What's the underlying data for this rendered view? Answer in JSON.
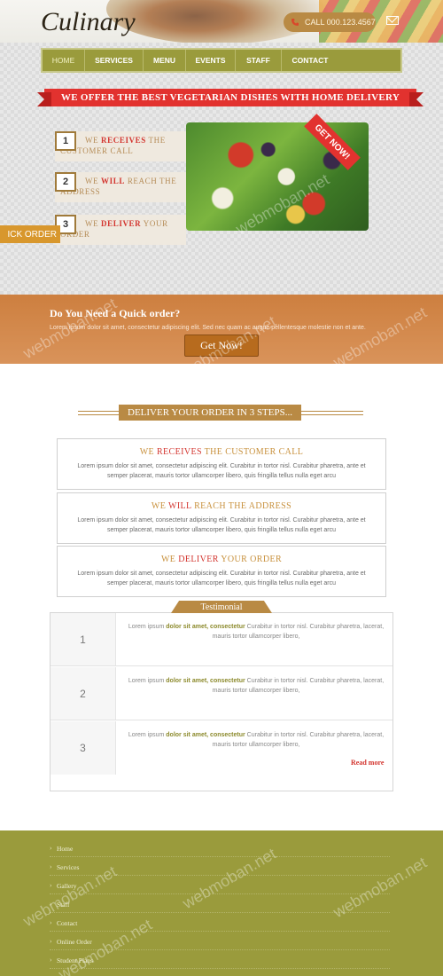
{
  "header": {
    "logo": "Culinary",
    "call_label": "CALL 000.123.4567",
    "phone_icon": "phone-icon",
    "mail_icon": "mail-icon"
  },
  "nav": {
    "items": [
      {
        "label": "HOME",
        "active": true
      },
      {
        "label": "SERVICES",
        "active": false
      },
      {
        "label": "MENU",
        "active": false
      },
      {
        "label": "EVENTS",
        "active": false
      },
      {
        "label": "STAFF",
        "active": false
      },
      {
        "label": "CONTACT",
        "active": false
      }
    ]
  },
  "hero": {
    "ribbon": "WE OFFER THE BEST VEGETARIAN DISHES WITH HOME DELIVERY",
    "steps": [
      {
        "number": "1",
        "pre": "WE ",
        "bold": "RECEIVES",
        "post": " THE CUSTOMER CALL"
      },
      {
        "number": "2",
        "pre": "WE ",
        "bold": "WILL",
        "post": " REACH THE ADDRESS"
      },
      {
        "number": "3",
        "pre": "WE ",
        "bold": "DELIVER",
        "post": " YOUR ORDER"
      }
    ],
    "quick_tab": "ICK ORDER",
    "get_now_badge": "GET NOW!"
  },
  "quick_order": {
    "title": "Do You Need a Quick order?",
    "description": "Lorem ipsum dolor sit amet, consectetur adipiscing elit. Sed nec quam ac augue pellentesque molestie non et ante.",
    "button": "Get Now!"
  },
  "deliver": {
    "heading": "DELIVER YOUR ORDER IN 3 STEPS...",
    "boxes": [
      {
        "pre": "WE ",
        "bold": "RECEIVES",
        "post": " THE CUSTOMER CALL",
        "text": "Lorem ipsum dolor sit amet, consectetur adipiscing elit. Curabitur in tortor nisl. Curabitur pharetra, ante et semper placerat, mauris tortor ullamcorper libero, quis fringilla tellus nulla eget arcu"
      },
      {
        "pre": "WE ",
        "bold": "WILL",
        "post": " REACH THE ADDRESS",
        "text": "Lorem ipsum dolor sit amet, consectetur adipiscing elit. Curabitur in tortor nisl. Curabitur pharetra, ante et semper placerat, mauris tortor ullamcorper libero, quis fringilla tellus nulla eget arcu"
      },
      {
        "pre": "WE ",
        "bold": "DELIVER",
        "post": " YOUR ORDER",
        "text": "Lorem ipsum dolor sit amet, consectetur adipiscing elit. Curabitur in tortor nisl. Curabitur pharetra, ante et semper placerat, mauris tortor ullamcorper libero, quis fringilla tellus nulla eget arcu"
      }
    ]
  },
  "testimonial": {
    "title": "Testimonial",
    "rows": [
      {
        "number": "1",
        "pre": "Lorem ipsum ",
        "bold": "dolor sit amet, consectetur",
        "post": " Curabitur in tortor nisl. Curabitur pharetra, lacerat, mauris tortor ullamcorper libero,"
      },
      {
        "number": "2",
        "pre": "Lorem ipsum ",
        "bold": "dolor sit amet, consectetur",
        "post": " Curabitur in tortor nisl. Curabitur pharetra, lacerat, mauris tortor ullamcorper libero,"
      },
      {
        "number": "3",
        "pre": "Lorem ipsum ",
        "bold": "dolor sit amet, consectetur",
        "post": " Curabitur in tortor nisl. Curabitur pharetra, lacerat, mauris tortor ullamcorper libero,"
      }
    ],
    "read_more": "Read more"
  },
  "footer": {
    "links": [
      "Home",
      "Services",
      "Gallery",
      "Staff",
      "Contact",
      "Online Order",
      "Student Plans"
    ]
  },
  "watermark": "webmoban.net",
  "colors": {
    "olive": "#9a9b3c",
    "red": "#e2322f",
    "gold": "#b98a44",
    "orange": "#d8972d"
  }
}
